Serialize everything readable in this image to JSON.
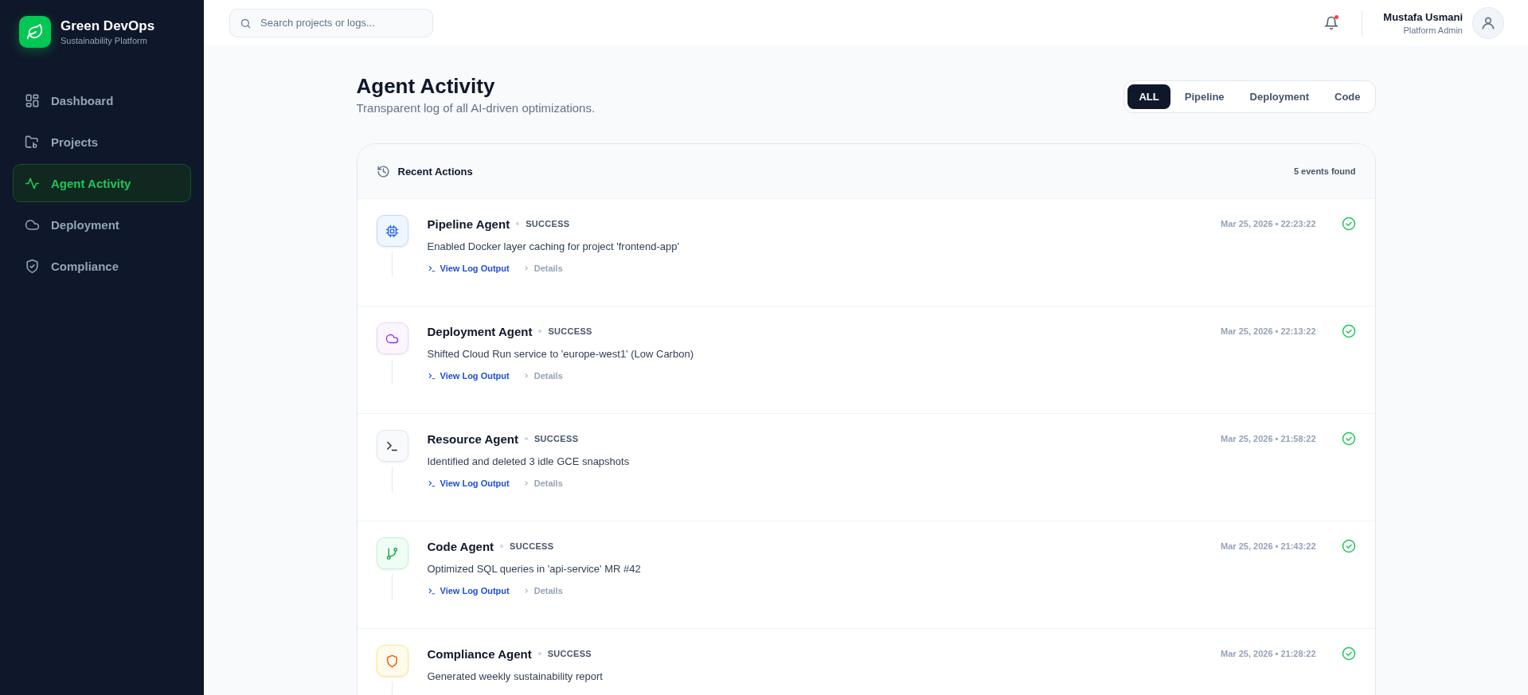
{
  "brand": {
    "name": "Green DevOps",
    "tagline": "Sustainability Platform"
  },
  "sidebar": {
    "items": [
      {
        "label": "Dashboard",
        "selected": false
      },
      {
        "label": "Projects",
        "selected": false
      },
      {
        "label": "Agent Activity",
        "selected": true
      },
      {
        "label": "Deployment",
        "selected": false
      },
      {
        "label": "Compliance",
        "selected": false
      }
    ]
  },
  "header": {
    "search": {
      "placeholder": "Search projects or logs..."
    },
    "notification_unread": true,
    "user": {
      "name": "Mustafa Usmani",
      "role": "Platform Admin"
    }
  },
  "page": {
    "title": "Agent Activity",
    "subtitle": "Transparent log of all AI-driven optimizations."
  },
  "filters": [
    {
      "label": "ALL",
      "selected": true
    },
    {
      "label": "Pipeline",
      "selected": false
    },
    {
      "label": "Deployment",
      "selected": false
    },
    {
      "label": "Code",
      "selected": false
    }
  ],
  "card": {
    "title": "Recent Actions",
    "count": "5 events found"
  },
  "events": [
    {
      "kind": "pipeline",
      "agent": "Pipeline Agent",
      "status": "SUCCESS",
      "message": "Enabled Docker layer caching for project 'frontend-app'",
      "time": "Mar 25, 2026 • 22:23:22",
      "links": [
        "View Log Output",
        "Details"
      ]
    },
    {
      "kind": "deployment",
      "agent": "Deployment Agent",
      "status": "SUCCESS",
      "message": "Shifted Cloud Run service to 'europe-west1' (Low Carbon)",
      "time": "Mar 25, 2026 • 22:13:22",
      "links": [
        "View Log Output",
        "Details"
      ]
    },
    {
      "kind": "resource",
      "agent": "Resource Agent",
      "status": "SUCCESS",
      "message": "Identified and deleted 3 idle GCE snapshots",
      "time": "Mar 25, 2026 • 21:58:22",
      "links": [
        "View Log Output",
        "Details"
      ]
    },
    {
      "kind": "code",
      "agent": "Code Agent",
      "status": "SUCCESS",
      "message": "Optimized SQL queries in 'api-service' MR #42",
      "time": "Mar 25, 2026 • 21:43:22",
      "links": [
        "View Log Output",
        "Details"
      ]
    },
    {
      "kind": "compliance",
      "agent": "Compliance Agent",
      "status": "SUCCESS",
      "message": "Generated weekly sustainability report",
      "time": "Mar 25, 2026 • 21:28:22"
    }
  ]
}
